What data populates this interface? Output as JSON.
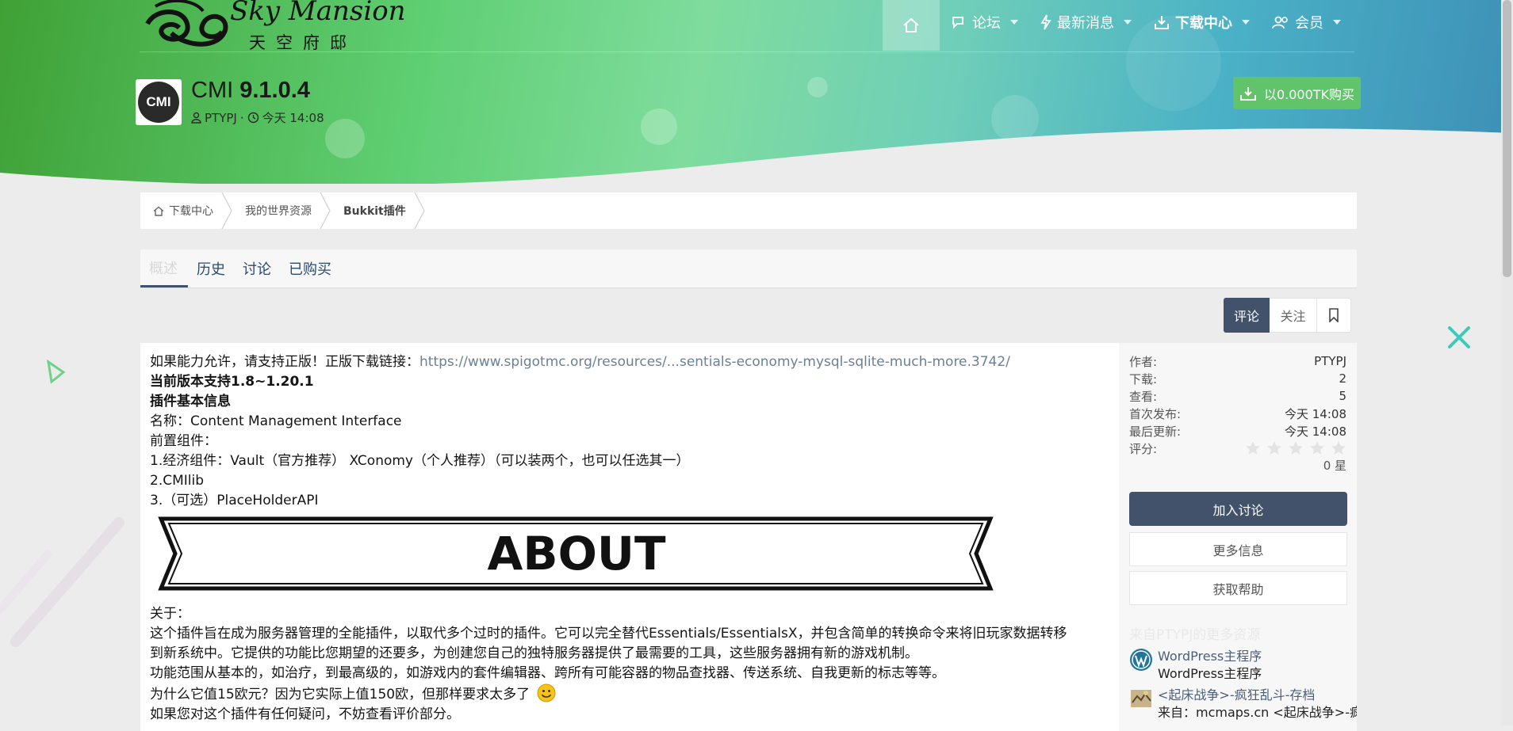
{
  "colors": {
    "accent": "#43526b",
    "buy": "#62c46a",
    "link": "#6b7f96"
  },
  "logo": {
    "text": "Sky Mansion",
    "subtitle": "天空府邸",
    "icon": "cloud-swirl-logo"
  },
  "nav": {
    "home_icon": "home-icon",
    "items": [
      {
        "label": "论坛",
        "icon": "chat-icon"
      },
      {
        "label": "最新消息",
        "icon": "bolt-icon"
      },
      {
        "label": "下载中心",
        "icon": "download-icon"
      },
      {
        "label": "会员",
        "icon": "users-icon"
      }
    ]
  },
  "resource": {
    "icon_text": "CMI",
    "title_name": "CMI",
    "title_version": "9.1.0.4",
    "author": "PTYPJ",
    "separator": "·",
    "date": "今天 14:08",
    "buy_label": "以0.000TK购买"
  },
  "breadcrumb": [
    "下载中心",
    "我的世界资源",
    "Bukkit插件"
  ],
  "tabs": [
    "概述",
    "历史",
    "讨论",
    "已购买"
  ],
  "actions": {
    "comment": "评论",
    "follow": "关注",
    "bookmark_icon": "bookmark-icon"
  },
  "content": {
    "line1_prefix": "如果能力允许，请支持正版！正版下载链接：",
    "line1_link": "https://www.spigotmc.org/resources/...sentials-economy-mysql-sqlite-much-more.3742/",
    "line2": "当前版本支持1.8~1.20.1",
    "line3": "插件基本信息",
    "line4": "名称：Content Management Interface",
    "line5": "前置组件：",
    "line6": "1.经济组件：Vault（官方推荐） XConomy（个人推荐）（可以装两个，也可以任选其一）",
    "line7": "2.CMIlib",
    "line8": "3.（可选）PlaceHolderAPI",
    "banner_text": "ABOUT",
    "line9": "关于：",
    "line10": "这个插件旨在成为服务器管理的全能插件，以取代多个过时的插件。它可以完全替代Essentials/EssentialsX，并包含简单的转换命令来将旧玩家数据转移",
    "line11": "到新系统中。它提供的功能比您期望的还要多，为创建您自己的独特服务器提供了最需要的工具，这些服务器拥有新的游戏机制。",
    "line12": "功能范围从基本的，如治疗，到最高级的，如游戏内的套件编辑器、跨所有可能容器的物品查找器、传送系统、自我更新的标志等等。",
    "line13": "为什么它值15欧元？因为它实际上值150欧，但那样要求太多了",
    "line14": "如果您对这个插件有任何疑问，不妨查看评价部分。"
  },
  "sidebar": {
    "stats": [
      {
        "k": "作者:",
        "v": "PTYPJ"
      },
      {
        "k": "下载:",
        "v": "2"
      },
      {
        "k": "查看:",
        "v": "5"
      },
      {
        "k": "首次发布:",
        "v": "今天 14:08"
      },
      {
        "k": "最后更新:",
        "v": "今天 14:08"
      }
    ],
    "rating_label": "评分:",
    "rating_value": 0,
    "rating_count": "0 星",
    "btn_join": "加入讨论",
    "btn_more": "更多信息",
    "btn_help": "获取帮助",
    "faded": "来自PTYPJ的更多资源",
    "related": [
      {
        "title": "WordPress主程序",
        "sub": "WordPress主程序",
        "icon": "wordpress-icon"
      },
      {
        "title": "<起床战争>-疯狂乱斗-存档",
        "sub": "来自：mcmaps.cn <起床战争>-疯",
        "icon": "map-icon"
      }
    ]
  }
}
